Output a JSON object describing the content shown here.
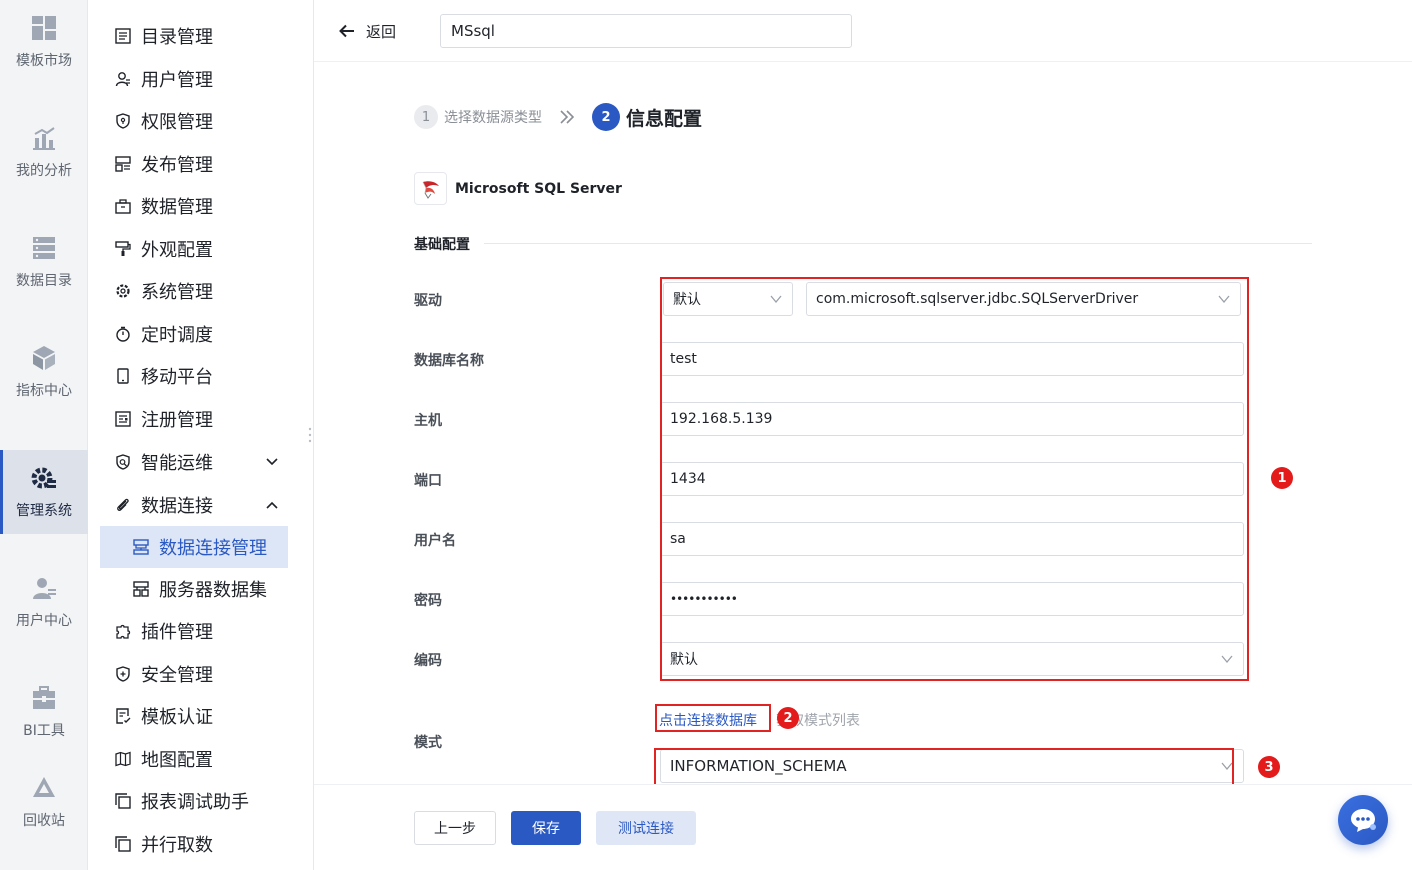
{
  "rail": {
    "items": [
      {
        "label": "模板市场",
        "icon": "grid-icon"
      },
      {
        "label": "我的分析",
        "icon": "chart-icon"
      },
      {
        "label": "数据目录",
        "icon": "database-icon"
      },
      {
        "label": "指标中心",
        "icon": "cube-icon"
      },
      {
        "label": "管理系统",
        "icon": "gear-icon",
        "active": true
      },
      {
        "label": "用户中心",
        "icon": "user-icon"
      },
      {
        "label": "BI工具",
        "icon": "toolbox-icon"
      },
      {
        "label": "回收站",
        "icon": "recycle-icon"
      }
    ]
  },
  "nav": {
    "items": [
      {
        "label": "目录管理"
      },
      {
        "label": "用户管理"
      },
      {
        "label": "权限管理"
      },
      {
        "label": "发布管理"
      },
      {
        "label": "数据管理"
      },
      {
        "label": "外观配置"
      },
      {
        "label": "系统管理"
      },
      {
        "label": "定时调度"
      },
      {
        "label": "移动平台"
      },
      {
        "label": "注册管理"
      },
      {
        "label": "智能运维"
      },
      {
        "label": "数据连接"
      },
      {
        "label": "数据连接管理"
      },
      {
        "label": "服务器数据集"
      },
      {
        "label": "插件管理"
      },
      {
        "label": "安全管理"
      },
      {
        "label": "模板认证"
      },
      {
        "label": "地图配置"
      },
      {
        "label": "报表调试助手"
      },
      {
        "label": "并行取数"
      }
    ]
  },
  "topbar": {
    "back_label": "返回",
    "connection_name": "MSsql"
  },
  "steps": {
    "step1_num": "1",
    "step1_label": "选择数据源类型",
    "step2_num": "2",
    "step2_label": "信息配置"
  },
  "datasource": {
    "name": "Microsoft SQL Server"
  },
  "section": {
    "title": "基础配置"
  },
  "form": {
    "driver_label": "驱动",
    "driver_mode": "默认",
    "driver_class": "com.microsoft.sqlserver.jdbc.SQLServerDriver",
    "dbname_label": "数据库名称",
    "dbname_value": "test",
    "host_label": "主机",
    "host_value": "192.168.5.139",
    "port_label": "端口",
    "port_value": "1434",
    "user_label": "用户名",
    "user_value": "sa",
    "password_label": "密码",
    "password_value": "•••••••••••",
    "encoding_label": "编码",
    "encoding_value": "默认",
    "schema_label": "模式",
    "schema_link": "点击连接数据库",
    "schema_hint": "获取模式列表",
    "schema_value": "INFORMATION_SCHEMA"
  },
  "badges": {
    "b1": "1",
    "b2": "2",
    "b3": "3"
  },
  "footer": {
    "prev_label": "上一步",
    "save_label": "保存",
    "test_label": "测试连接"
  },
  "colors": {
    "primary": "#2b59c3",
    "annotation_red": "#e02424"
  }
}
